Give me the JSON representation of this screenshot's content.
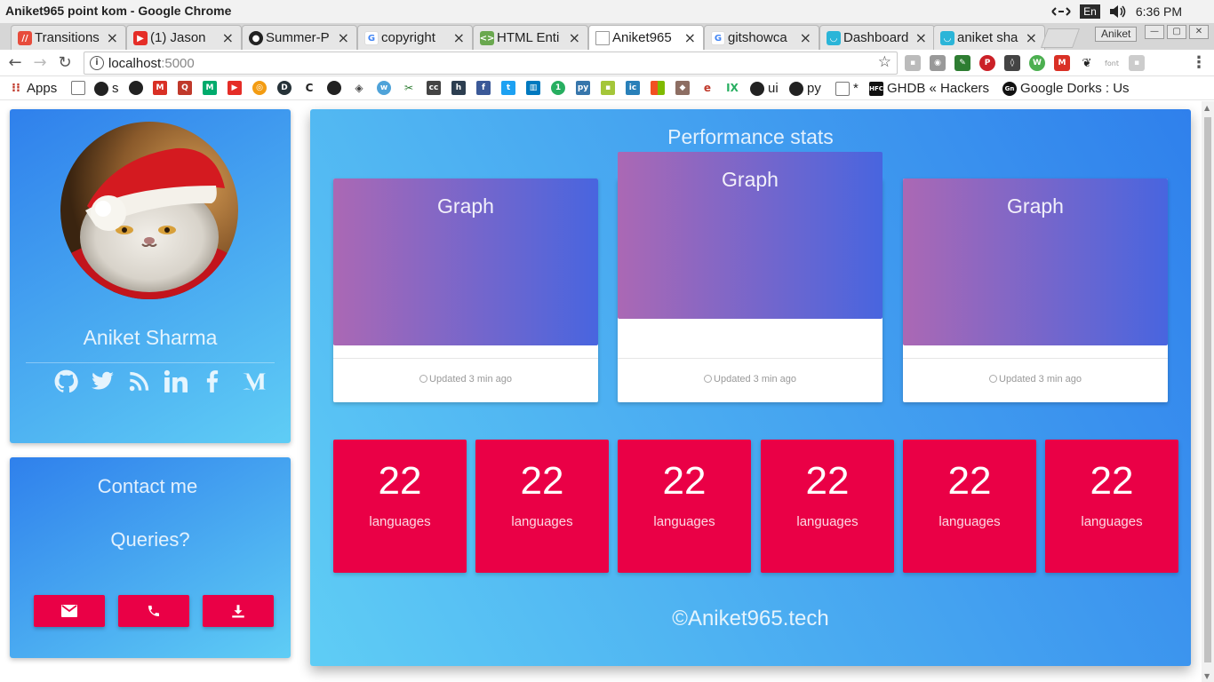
{
  "os": {
    "window_title": "Aniket965 point kom - Google Chrome",
    "lang": "En",
    "time": "6:36 PM"
  },
  "browser": {
    "tabs": [
      {
        "label": "Transitions",
        "icon": "tab-favicon-transitions",
        "color": "#e74c3c"
      },
      {
        "label": "(1) Jason",
        "icon": "youtube-icon",
        "color": "#e52d27"
      },
      {
        "label": "Summer-P",
        "icon": "github-icon",
        "color": "#222222"
      },
      {
        "label": "copyright",
        "icon": "google-icon",
        "color": "#4285f4"
      },
      {
        "label": "HTML Enti",
        "icon": "tab-favicon-html-entities",
        "color": "#6aa84f"
      },
      {
        "label": "Aniket965",
        "icon": "document-icon",
        "color": "#777777"
      },
      {
        "label": "gitshowca",
        "icon": "google-icon",
        "color": "#4285f4"
      },
      {
        "label": "Dashboard",
        "icon": "tab-favicon-dashboard",
        "color": "#2bb5d8"
      },
      {
        "label": "aniket sha",
        "icon": "tab-favicon-aniket",
        "color": "#2bb5d8"
      }
    ],
    "active_tab": 5,
    "profile_name": "Aniket",
    "url_host": "localhost",
    "url_port": ":5000",
    "bookmarks": [
      {
        "label": "Apps",
        "icon": "apps-grid-icon"
      },
      {
        "label": "s",
        "icon": "github-icon"
      },
      {
        "label": "ui",
        "icon": "github-icon"
      },
      {
        "label": "py",
        "icon": "github-icon"
      },
      {
        "label": "*",
        "icon": "document-icon"
      },
      {
        "label": "GHDB « Hackers",
        "icon": "hfc-icon"
      },
      {
        "label": "Google Dorks : Us",
        "icon": "gn-icon"
      }
    ]
  },
  "profile": {
    "name": "Aniket Sharma",
    "avatar_alt": "cat-in-santa-hat",
    "socials": [
      "github-icon",
      "twitter-icon",
      "rss-icon",
      "linkedin-icon",
      "facebook-icon",
      "medium-icon"
    ]
  },
  "contact": {
    "title": "Contact me",
    "subtitle": "Queries?",
    "buttons": [
      "email-icon",
      "phone-icon",
      "download-icon"
    ]
  },
  "performance": {
    "title": "Performance stats",
    "graphs": [
      {
        "title": "Graph",
        "updated": "Updated 3 min ago"
      },
      {
        "title": "Graph",
        "updated": "Updated 3 min ago"
      },
      {
        "title": "Graph",
        "updated": "Updated 3 min ago"
      }
    ],
    "stats": [
      {
        "value": "22",
        "label": "languages"
      },
      {
        "value": "22",
        "label": "languages"
      },
      {
        "value": "22",
        "label": "languages"
      },
      {
        "value": "22",
        "label": "languages"
      },
      {
        "value": "22",
        "label": "languages"
      },
      {
        "value": "22",
        "label": "languages"
      }
    ]
  },
  "footer": "©Aniket965.tech",
  "colors": {
    "accent_red": "#ea0046",
    "card_blue": "#2f80ec",
    "card_cyan": "#5fcdf5",
    "graph_purple": "#ab68b4",
    "graph_blue": "#4865df"
  }
}
